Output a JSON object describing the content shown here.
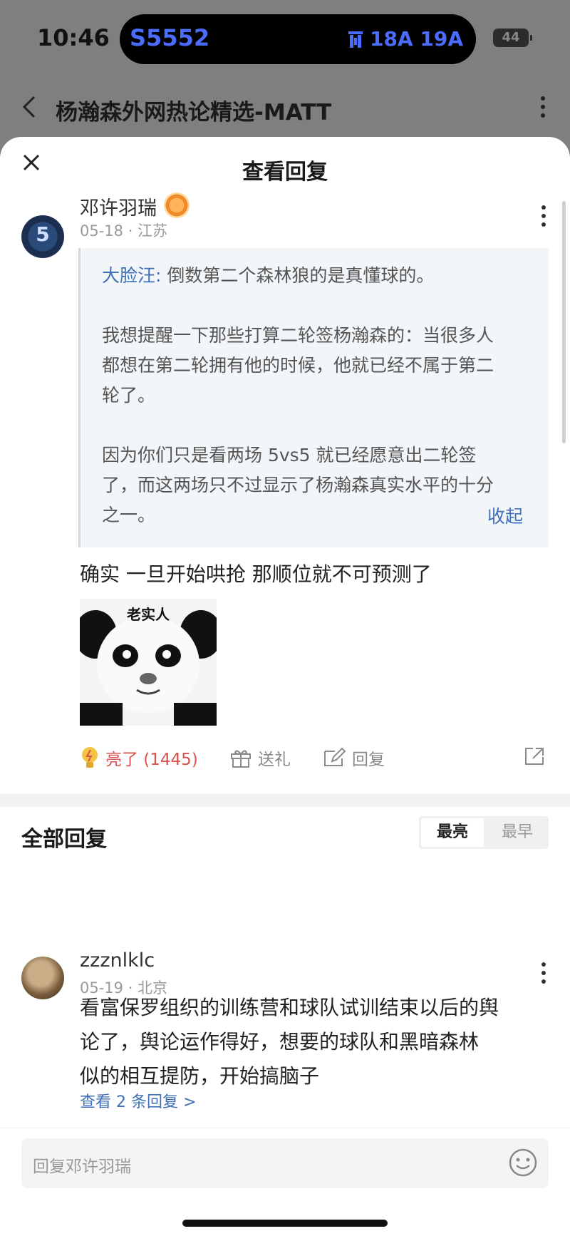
{
  "status_bar": {
    "time": "10:46",
    "island_left": "S5552",
    "island_right": "18A 19A",
    "battery": "44"
  },
  "page": {
    "title": "杨瀚森外网热论精选-MATT"
  },
  "sheet": {
    "title": "查看回复"
  },
  "main_comment": {
    "username": "邓许羽瑞",
    "meta": "05-18 · 江苏",
    "quote": {
      "author": "大脸汪:",
      "paragraph1": "倒数第二个森林狼的是真懂球的。",
      "paragraph2_line1": "我想提醒一下那些打算二轮签杨瀚森的：当很多人",
      "paragraph2_line2": "都想在第二轮拥有他的时候，他就已经不属于第二",
      "paragraph2_line3": "轮了。",
      "paragraph3_line1": "因为你们只是看两场 5vs5 就已经愿意出二轮签",
      "paragraph3_line2": "了，而这两场只不过显示了杨瀚森真实水平的十分",
      "paragraph3_line3": "之一。",
      "collapse": "收起"
    },
    "text": "确实 一旦开始哄抢 那顺位就不可预测了",
    "sticker_caption": "老实人",
    "actions": {
      "like": "亮了 (1445)",
      "gift": "送礼",
      "reply": "回复"
    }
  },
  "replies_section": {
    "title": "全部回复",
    "sort_options": [
      "最亮",
      "最早"
    ]
  },
  "reply": {
    "username": "zzznlklc",
    "meta": "05-19 · 北京",
    "line1": "看富保罗组织的训练营和球队试训结束以后的舆",
    "line2": "论了，舆论运作得好，想要的球队和黑暗森林",
    "line3": "似的相互提防，开始搞脑子",
    "more": "查看 2 条回复 >"
  },
  "input": {
    "placeholder": "回复邓许羽瑞"
  },
  "colors": {
    "link": "#3e6fb8",
    "like": "#d9534f",
    "accent": "#4a6cff"
  }
}
